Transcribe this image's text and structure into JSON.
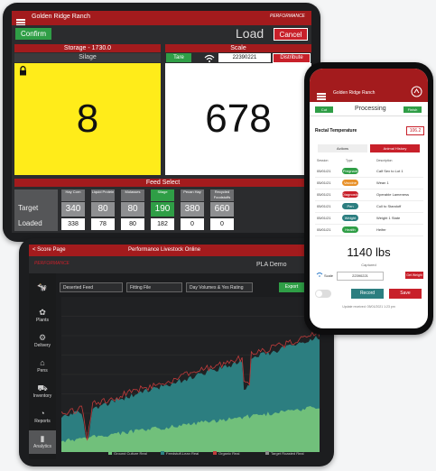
{
  "tablet_load": {
    "title": "Golden Ridge Ranch",
    "logo_text": "PERFORMANCE",
    "confirm_label": "Confirm",
    "page_title": "Load",
    "cancel_label": "Cancel",
    "storage": {
      "title": "Storage - 1730.0",
      "subtitle": "Silage",
      "value": "8"
    },
    "scale": {
      "title": "Scale",
      "tare_label": "Tare",
      "id": "22390221",
      "distribute_label": "Distribute",
      "value": "678"
    },
    "feed_select": {
      "title": "Feed Select",
      "target_label": "Target",
      "loaded_label": "Loaded",
      "columns": [
        {
          "name": "Hay Corn",
          "target": "340",
          "loaded": "338",
          "active": false
        },
        {
          "name": "Liquid Protein",
          "target": "80",
          "loaded": "78",
          "active": false
        },
        {
          "name": "Molasses",
          "target": "80",
          "loaded": "80",
          "active": false
        },
        {
          "name": "Silage",
          "target": "190",
          "loaded": "182",
          "active": true
        },
        {
          "name": "Pecan Hay",
          "target": "380",
          "loaded": "0",
          "active": false
        },
        {
          "name": "Recycled Foodstuffs Cows",
          "target": "660",
          "loaded": "0",
          "active": false
        }
      ]
    },
    "colors": {
      "brand_red": "#a31b1d",
      "storage_yellow": "#ffec1a",
      "active_green": "#2f9e46"
    }
  },
  "tablet_chart": {
    "back_label": "< Score Page",
    "title": "Performance Livestock Online",
    "logo_text": "PERFORMANCE",
    "subtitle": "PLA Demo",
    "filters": [
      "Deserted Feed",
      "Fitting File",
      "Day Volumes & Yes Rating"
    ],
    "export_label": "Export",
    "sidebar": [
      {
        "icon": "cow-icon",
        "label": ""
      },
      {
        "icon": "leaf-icon",
        "label": "Plants"
      },
      {
        "icon": "tractor-icon",
        "label": "Delivery"
      },
      {
        "icon": "barn-icon",
        "label": "Pens"
      },
      {
        "icon": "truck-icon",
        "label": "Inventory"
      },
      {
        "icon": "gauge-icon",
        "label": "Reports"
      },
      {
        "icon": "chart-icon",
        "label": "Analytics"
      }
    ],
    "legend": [
      "Ground Culture Real",
      "Feedstuff-Lean Real",
      "Organic Real",
      "Target Roasted Real"
    ],
    "colors": {
      "teal": "#2c7e80",
      "light_green": "#71c07b",
      "red_line": "#c03b3b"
    }
  },
  "phone": {
    "title": "Golden Ridge Ranch",
    "cancel_label": "Cut",
    "page_title": "Processing",
    "confirm_label": "Finish",
    "temp_label": "Rectal Temperature",
    "temp_value": "106.2",
    "tab_actions": "Actions",
    "tab_history": "Animal History",
    "col_session": "Session",
    "col_type": "Type",
    "col_description": "Description",
    "history": [
      {
        "date": "05/01/21",
        "tag": "Pregnant",
        "color": "#2f9e46",
        "desc": "Calf Sex to Lot 1"
      },
      {
        "date": "05/01/21",
        "tag": "Vaccine",
        "color": "#e8912a",
        "desc": "Wean 1"
      },
      {
        "date": "05/01/21",
        "tag": "Diagnostic",
        "color": "#c8202a",
        "desc": "Operable Lameness"
      },
      {
        "date": "05/01/21",
        "tag": "Pen",
        "color": "#2c7e80",
        "desc": "Cull to Standoff"
      },
      {
        "date": "05/01/21",
        "tag": "Weight",
        "color": "#2c7e80",
        "desc": "Weight 1 State"
      },
      {
        "date": "05/01/21",
        "tag": "Health",
        "color": "#2f9e46",
        "desc": "Heifer"
      }
    ],
    "weight": "1140 lbs",
    "weight_caption": "Captured",
    "scale_label": "Scale",
    "scale_id": "22390221",
    "scale_button": "Get Weight",
    "record_button": "Record",
    "save_button": "Save",
    "footer": "Update received: 05/01/2021 1:23 pm"
  }
}
